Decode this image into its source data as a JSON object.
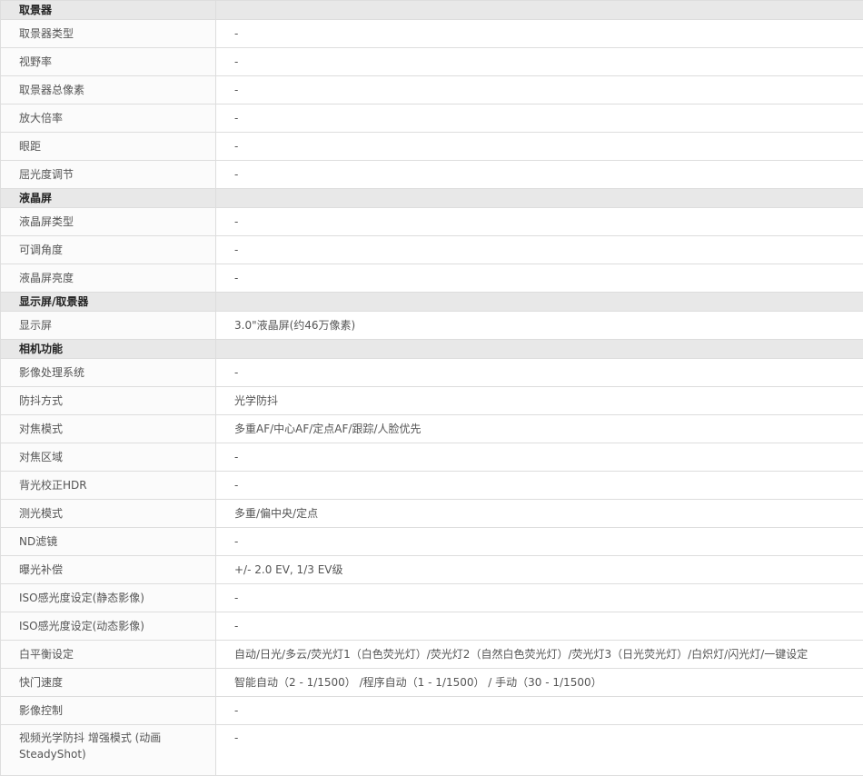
{
  "sections": [
    {
      "title": "取景器",
      "rows": [
        {
          "label": "取景器类型",
          "value": "-"
        },
        {
          "label": "视野率",
          "value": "-"
        },
        {
          "label": "取景器总像素",
          "value": "-"
        },
        {
          "label": "放大倍率",
          "value": "-"
        },
        {
          "label": "眼距",
          "value": "-"
        },
        {
          "label": "屈光度调节",
          "value": "-"
        }
      ]
    },
    {
      "title": "液晶屏",
      "rows": [
        {
          "label": "液晶屏类型",
          "value": "-"
        },
        {
          "label": "可调角度",
          "value": "-"
        },
        {
          "label": "液晶屏亮度",
          "value": "-"
        }
      ]
    },
    {
      "title": "显示屏/取景器",
      "rows": [
        {
          "label": "显示屏",
          "value": "3.0\"液晶屏(约46万像素)"
        }
      ]
    },
    {
      "title": "相机功能",
      "rows": [
        {
          "label": "影像处理系统",
          "value": "-"
        },
        {
          "label": "防抖方式",
          "value": "光学防抖"
        },
        {
          "label": "对焦模式",
          "value": "多重AF/中心AF/定点AF/跟踪/人脸优先"
        },
        {
          "label": "对焦区域",
          "value": "-"
        },
        {
          "label": "背光校正HDR",
          "value": "-"
        },
        {
          "label": "测光模式",
          "value": "多重/偏中央/定点"
        },
        {
          "label": "ND滤镜",
          "value": "-"
        },
        {
          "label": "曝光补偿",
          "value": "+/- 2.0 EV, 1/3 EV级"
        },
        {
          "label": "ISO感光度设定(静态影像)",
          "value": "-"
        },
        {
          "label": "ISO感光度设定(动态影像)",
          "value": "-"
        },
        {
          "label": "白平衡设定",
          "value": "自动/日光/多云/荧光灯1（白色荧光灯）/荧光灯2（自然白色荧光灯）/荧光灯3（日光荧光灯）/白炽灯/闪光灯/一键设定"
        },
        {
          "label": "快门速度",
          "value": "智能自动（2 - 1/1500） /程序自动（1 - 1/1500） / 手动（30 - 1/1500）"
        },
        {
          "label": "影像控制",
          "value": "-"
        },
        {
          "label": "视频光学防抖 增强模式 (动画 SteadyShot)",
          "value": "-"
        }
      ]
    }
  ]
}
